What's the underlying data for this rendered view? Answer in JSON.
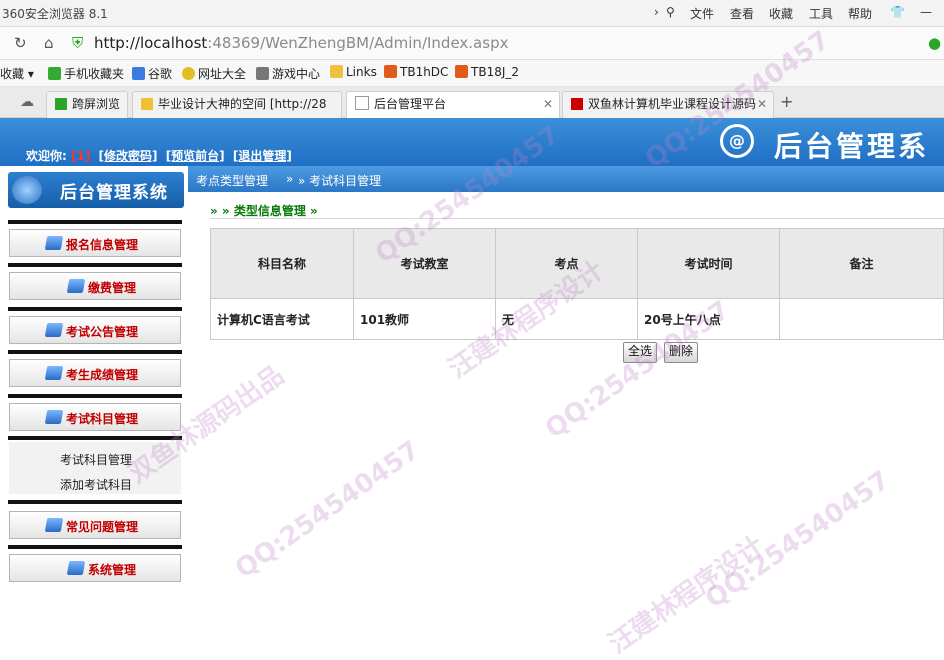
{
  "browser": {
    "title": "360安全浏览器 8.1",
    "menu": [
      "文件",
      "查看",
      "收藏",
      "工具",
      "帮助"
    ],
    "url_host": "http://localhost",
    "url_rest": ":48369/WenZhengBM/Admin/Index.aspx",
    "bookmarks": [
      "收藏",
      "手机收藏夹",
      "谷歌",
      "网址大全",
      "游戏中心",
      "Links",
      "TB1hDC",
      "TB18J_2"
    ],
    "tabs": [
      "跨屏浏览",
      "毕业设计大神的空间 [http://28",
      "后台管理平台",
      "双鱼林计算机毕业课程设计源码"
    ],
    "active_tab": 2
  },
  "header": {
    "welcome_prefix": "欢迎你:",
    "user_num": "[1]",
    "links": [
      "[修改密码]",
      "[预览前台]",
      "[退出管理]"
    ],
    "logo_text": "后台管理系",
    "logo_mark": "@"
  },
  "sidebar": {
    "logo_text": "后台管理系统",
    "items": [
      "报名信息管理",
      "缴费管理",
      "考试公告管理",
      "考生成绩管理",
      "考试科目管理",
      "常见问题管理",
      "系统管理"
    ],
    "subitems": [
      "考试科目管理",
      "添加考试科目"
    ]
  },
  "main": {
    "crumb1": "考点类型管理",
    "crumb_sep": "»",
    "crumb2": "» 考试科目管理",
    "panel_title": "» » 类型信息管理 »",
    "table": {
      "headers": [
        "科目名称",
        "考试教室",
        "考点",
        "考试时间",
        "备注"
      ],
      "rows": [
        [
          "计算机C语言考试",
          "101教师",
          "无",
          "20号上午八点",
          ""
        ]
      ]
    },
    "select_all": "全选",
    "delete": "删除"
  },
  "watermark": {
    "qq": "QQ:254540457",
    "a": "汪建林程序设计",
    "b": "双鱼林源码出品"
  }
}
